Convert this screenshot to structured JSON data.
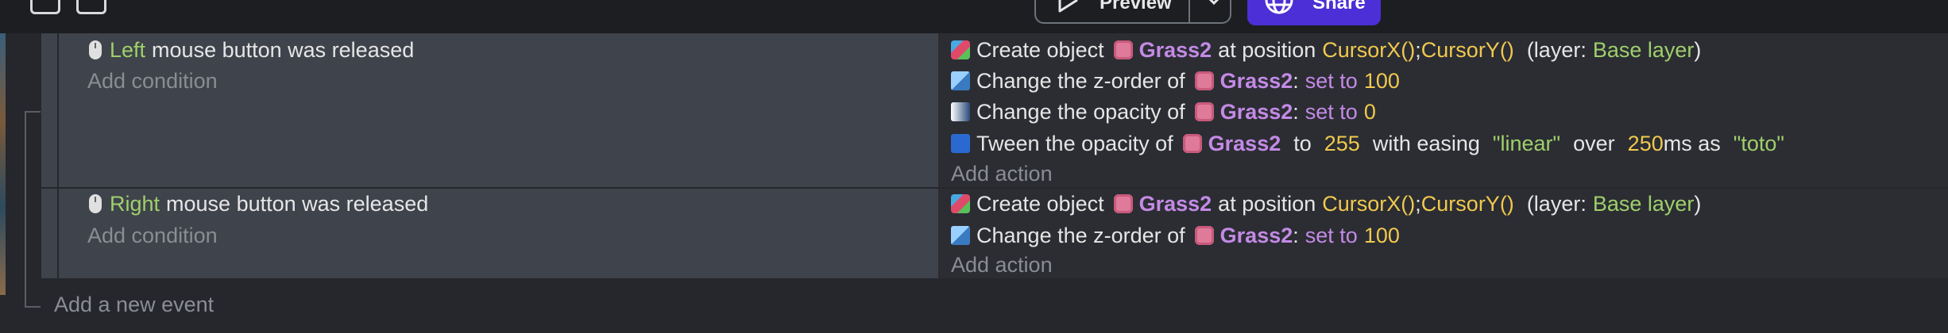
{
  "toolbar": {
    "preview_label": "Preview",
    "share_label": "Share"
  },
  "events": [
    {
      "condition": {
        "button": "Left",
        "text": "mouse button was released"
      },
      "add_condition": "Add condition",
      "actions": [
        {
          "prefix": "Create object",
          "object": "Grass2",
          "mid": "at position",
          "x": "CursorX()",
          "sep": ";",
          "y": "CursorY()",
          "layer_open": "(layer:",
          "layer": "Base layer",
          "layer_close": ")"
        },
        {
          "prefix": "Change the z-order of",
          "object": "Grass2",
          "colon": ":",
          "op": "set to",
          "value": "100"
        },
        {
          "prefix": "Change the opacity of",
          "object": "Grass2",
          "colon": ":",
          "op": "set to",
          "value": "0"
        },
        {
          "prefix": "Tween the opacity of",
          "object": "Grass2",
          "to": "to",
          "value": "255",
          "with": "with easing",
          "easing": "\"linear\"",
          "over": "over",
          "duration": "250",
          "ms_as": "ms as",
          "id": "\"toto\""
        }
      ],
      "add_action": "Add action"
    },
    {
      "condition": {
        "button": "Right",
        "text": "mouse button was released"
      },
      "add_condition": "Add condition",
      "actions": [
        {
          "prefix": "Create object",
          "object": "Grass2",
          "mid": "at position",
          "x": "CursorX()",
          "sep": ";",
          "y": "CursorY()",
          "layer_open": "(layer:",
          "layer": "Base layer",
          "layer_close": ")"
        },
        {
          "prefix": "Change the z-order of",
          "object": "Grass2",
          "colon": ":",
          "op": "set to",
          "value": "100"
        }
      ],
      "add_action": "Add action"
    }
  ],
  "add_event": "Add a new event",
  "icons": {
    "toolbar": [
      "layout-icon",
      "save-icon"
    ],
    "preview": "play-icon",
    "share": "globe-icon",
    "condition": "mouse-icon",
    "object": "grass-sprite-icon"
  },
  "colors": {
    "background": "#25272d",
    "share_button": "#4c2fd6",
    "object_name": "#c48ae6",
    "expression": "#f0c94d",
    "layer_and_string": "#9fcf6b"
  }
}
